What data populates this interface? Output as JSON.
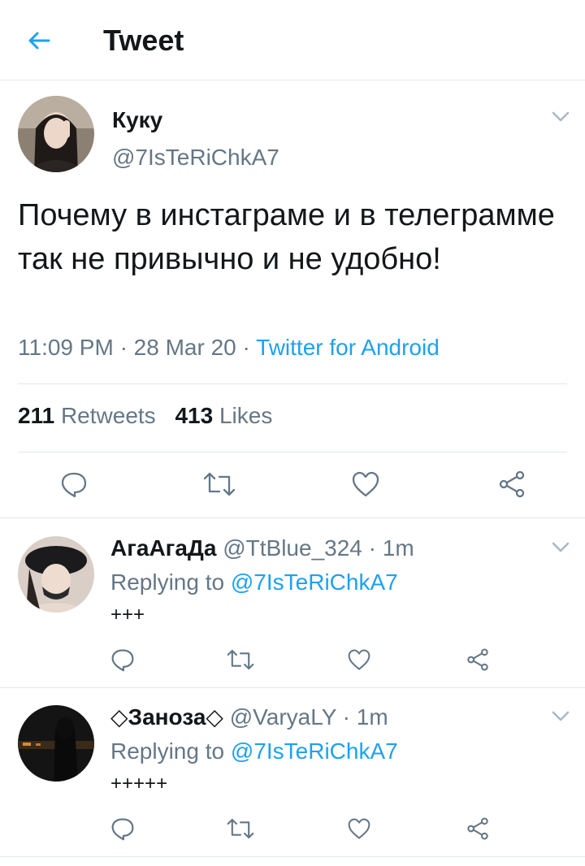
{
  "header": {
    "title": "Tweet",
    "back_icon": "arrow-left-icon"
  },
  "colors": {
    "accent": "#1da1f2",
    "secondary_text": "#657786",
    "border": "#e1e8ed",
    "primary_text": "#14171a"
  },
  "main_tweet": {
    "display_name": "Куку",
    "handle": "@7IsTeRiChkA7",
    "text": "Почему в инстаграме и в телеграмме так не привычно и не удобно!",
    "time": "11:09 PM",
    "date": "28 Mar 20",
    "separator": "·",
    "source": "Twitter for Android",
    "retweets_count": "211",
    "retweets_label": "Retweets",
    "likes_count": "413",
    "likes_label": "Likes"
  },
  "replies": [
    {
      "display_name": "АгаАгаДа",
      "handle": "@TtBlue_324",
      "time": "1m",
      "replying_prefix": "Replying to",
      "replying_to": "@7IsTeRiChkA7",
      "text": "+++"
    },
    {
      "display_name": "◇Заноза◇",
      "handle": "@VaryaLY",
      "time": "1m",
      "replying_prefix": "Replying to",
      "replying_to": "@7IsTeRiChkA7",
      "text": "+++++"
    }
  ]
}
